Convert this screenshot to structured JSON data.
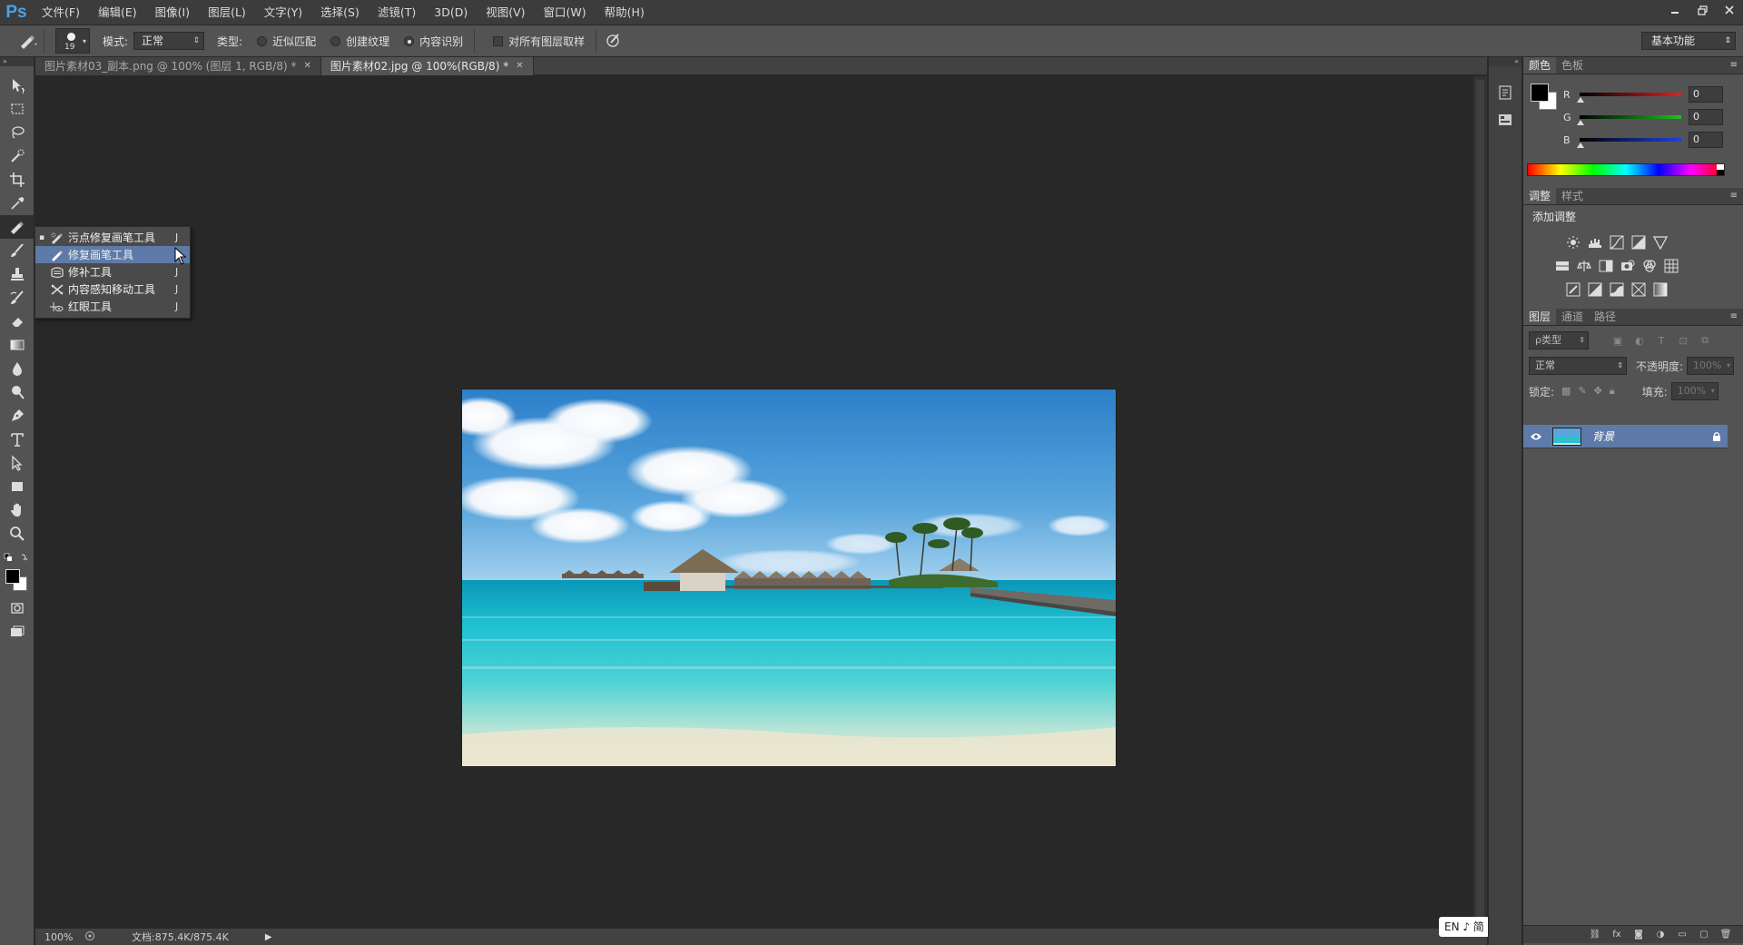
{
  "app": {
    "logo": "Ps",
    "menu": [
      "文件(F)",
      "编辑(E)",
      "图像(I)",
      "图层(L)",
      "文字(Y)",
      "选择(S)",
      "滤镜(T)",
      "3D(D)",
      "视图(V)",
      "窗口(W)",
      "帮助(H)"
    ],
    "window_controls": [
      "minimize-icon",
      "restore-icon",
      "close-icon"
    ]
  },
  "options_bar": {
    "brush_size": "19",
    "mode_label": "模式:",
    "mode_value": "正常",
    "type_label": "类型:",
    "type_options": [
      {
        "label": "近似匹配",
        "selected": false
      },
      {
        "label": "创建纹理",
        "selected": false
      },
      {
        "label": "内容识别",
        "selected": true
      }
    ],
    "sample_all_layers": {
      "label": "对所有图层取样",
      "checked": false
    },
    "workspace": "基本功能"
  },
  "tabs": [
    {
      "label": "图片素材03_副本.png @ 100% (图层 1, RGB/8) *",
      "active": false
    },
    {
      "label": "图片素材02.jpg @ 100%(RGB/8) *",
      "active": true
    }
  ],
  "tools": [
    "move-tool",
    "marquee-tool",
    "lasso-tool",
    "quick-select-tool",
    "crop-tool",
    "eyedropper-tool",
    "healing-brush-tool",
    "brush-tool",
    "clone-stamp-tool",
    "history-brush-tool",
    "eraser-tool",
    "gradient-tool",
    "blur-tool",
    "dodge-tool",
    "pen-tool",
    "type-tool",
    "path-select-tool",
    "rectangle-tool",
    "hand-tool",
    "zoom-tool"
  ],
  "flyout": {
    "items": [
      {
        "label": "污点修复画笔工具",
        "key": "J",
        "current": true,
        "hover": false,
        "icon": "spot-healing-brush-icon"
      },
      {
        "label": "修复画笔工具",
        "key": "J",
        "current": false,
        "hover": true,
        "icon": "healing-brush-icon"
      },
      {
        "label": "修补工具",
        "key": "J",
        "current": false,
        "hover": false,
        "icon": "patch-icon"
      },
      {
        "label": "内容感知移动工具",
        "key": "J",
        "current": false,
        "hover": false,
        "icon": "content-aware-move-icon"
      },
      {
        "label": "红眼工具",
        "key": "J",
        "current": false,
        "hover": false,
        "icon": "red-eye-icon"
      }
    ],
    "bullet": "▪"
  },
  "status": {
    "zoom": "100%",
    "doc_info": "文档:875.4K/875.4K",
    "ime": "EN ♪ 简"
  },
  "panels": {
    "color": {
      "tabs": [
        "颜色",
        "色板"
      ],
      "channels": [
        {
          "label": "R",
          "value": "0",
          "color": "#e02020"
        },
        {
          "label": "G",
          "value": "0",
          "color": "#20c020"
        },
        {
          "label": "B",
          "value": "0",
          "color": "#2040e0"
        }
      ],
      "foreground": "#000000",
      "background": "#ffffff"
    },
    "adjustments": {
      "tabs": [
        "调整",
        "样式"
      ],
      "title": "添加调整"
    },
    "layers": {
      "tabs": [
        "图层",
        "通道",
        "路径"
      ],
      "filter": "ρ类型",
      "blend_mode": "正常",
      "opacity_label": "不透明度:",
      "opacity_value": "100%",
      "lock_label": "锁定:",
      "fill_label": "填充:",
      "fill_value": "100%",
      "layer_name": "背景"
    }
  }
}
